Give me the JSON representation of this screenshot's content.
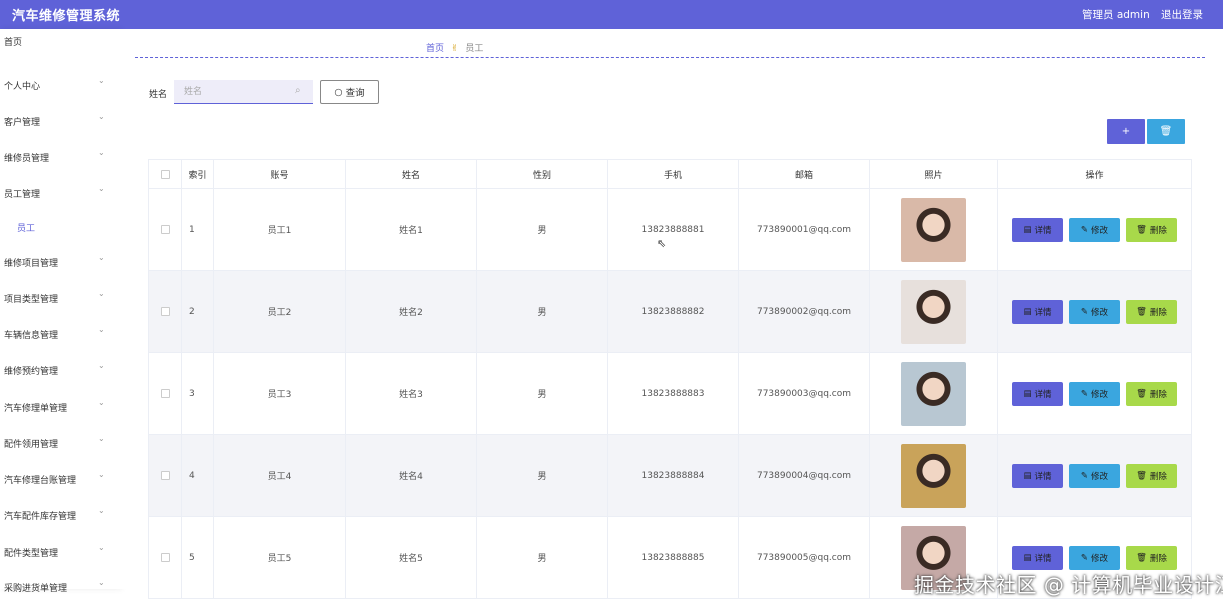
{
  "app": {
    "title": "汽车维修管理系统",
    "user": "管理员 admin",
    "logout": "退出登录"
  },
  "sidebar": {
    "items": [
      {
        "label": "首页",
        "chevron": false
      },
      {
        "label": "个人中心",
        "chevron": true
      },
      {
        "label": "客户管理",
        "chevron": true
      },
      {
        "label": "维修员管理",
        "chevron": true
      },
      {
        "label": "员工管理",
        "chevron": true
      },
      {
        "label": "员工",
        "chevron": false,
        "sub": true
      },
      {
        "label": "维修项目管理",
        "chevron": true
      },
      {
        "label": "项目类型管理",
        "chevron": true
      },
      {
        "label": "车辆信息管理",
        "chevron": true
      },
      {
        "label": "维修预约管理",
        "chevron": true
      },
      {
        "label": "汽车修理单管理",
        "chevron": true
      },
      {
        "label": "配件领用管理",
        "chevron": true
      },
      {
        "label": "汽车修理台账管理",
        "chevron": true
      },
      {
        "label": "汽车配件库存管理",
        "chevron": true
      },
      {
        "label": "配件类型管理",
        "chevron": true
      },
      {
        "label": "采购进货单管理",
        "chevron": true
      }
    ]
  },
  "breadcrumb": {
    "home": "首页",
    "current": "员工"
  },
  "search": {
    "label": "姓名",
    "placeholder": "姓名",
    "button": "查询"
  },
  "toolbar": {
    "add": "+",
    "delete": "🗑"
  },
  "table": {
    "headers": [
      "索引",
      "账号",
      "姓名",
      "性别",
      "手机",
      "邮箱",
      "照片",
      "操作"
    ],
    "rows": [
      {
        "index": "1",
        "account": "员工1",
        "name": "姓名1",
        "gender": "男",
        "phone": "13823888881",
        "email": "773890001@qq.com",
        "photo_color": "#d9b9a8"
      },
      {
        "index": "2",
        "account": "员工2",
        "name": "姓名2",
        "gender": "男",
        "phone": "13823888882",
        "email": "773890002@qq.com",
        "photo_color": "#e7e0dc"
      },
      {
        "index": "3",
        "account": "员工3",
        "name": "姓名3",
        "gender": "男",
        "phone": "13823888883",
        "email": "773890003@qq.com",
        "photo_color": "#b8c7d2"
      },
      {
        "index": "4",
        "account": "员工4",
        "name": "姓名4",
        "gender": "男",
        "phone": "13823888884",
        "email": "773890004@qq.com",
        "photo_color": "#c9a35a"
      },
      {
        "index": "5",
        "account": "员工5",
        "name": "姓名5",
        "gender": "男",
        "phone": "13823888885",
        "email": "773890005@qq.com",
        "photo_color": "#c5a9a6"
      }
    ],
    "actions": {
      "detail": "详情",
      "edit": "修改",
      "delete": "删除"
    }
  },
  "watermark": "掘金技术社区 @ 计算机毕业设计江挽",
  "colors": {
    "primary": "#5f62d8",
    "info": "#3aa6df",
    "success": "#a8d94a"
  }
}
